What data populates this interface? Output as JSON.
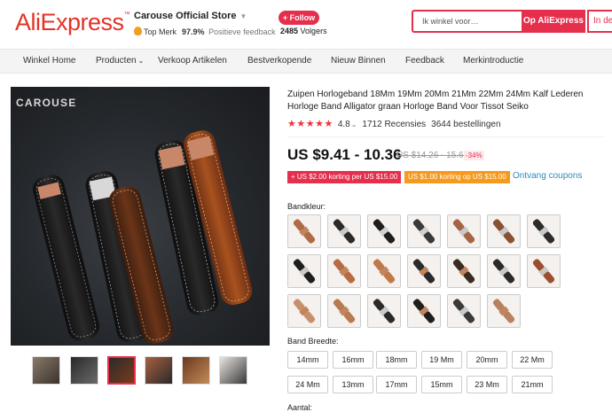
{
  "header": {
    "logo": "AliExpress",
    "store_name": "Carouse Official Store",
    "badge": "Top Merk",
    "feedback_pct": "97.9%",
    "feedback_label": "Positieve feedback",
    "follow_label": "+ Follow",
    "followers_count": "2485",
    "followers_label": "Volgers",
    "search_placeholder": "Ik winkel voor…",
    "search_button": "Op AliExpress",
    "search_button_2": "In de"
  },
  "nav": {
    "items": [
      "Winkel Home",
      "Producten",
      "Verkoop Artikelen",
      "Bestverkopende",
      "Nieuw Binnen",
      "Feedback",
      "Merkintroductie"
    ]
  },
  "gallery": {
    "brand_mark": "CAROUSE",
    "thumb_count": 6,
    "active_thumb": 3
  },
  "product": {
    "title": "Zuipen Horlogeband 18Mm 19Mm 20Mm 21Mm 22Mm 24Mm Kalf Lederen Horloge Band Alligator graan Horloge Band Voor Tissot Seiko",
    "stars": "★★★★★",
    "rating": "4.8",
    "reviews": "1712 Recensies",
    "orders": "3644 bestellingen",
    "price": "US $9.41 - 10.36",
    "old_price": "US $14.26 - 15.69",
    "discount": "-34%",
    "coupon_1": "+ US $2.00 korting per US $15.00",
    "coupon_2": "US $1.00 korting op US $15.00",
    "coupon_link": "Ontvang coupons",
    "color_label": "Bandkleur:",
    "width_label": "Band Breedte:",
    "quantity_label": "Aantal:",
    "sizes": [
      "14mm",
      "16mm",
      "18mm",
      "19 Mm",
      "20mm",
      "22 Mm",
      "24 Mm",
      "13mm",
      "17mm",
      "15mm",
      "23 Mm",
      "21mm"
    ]
  },
  "colors": {
    "accent": "#e62e4d",
    "logo": "#e43225",
    "coupon_orange": "#f59a1d",
    "link": "#2e8ab8"
  }
}
